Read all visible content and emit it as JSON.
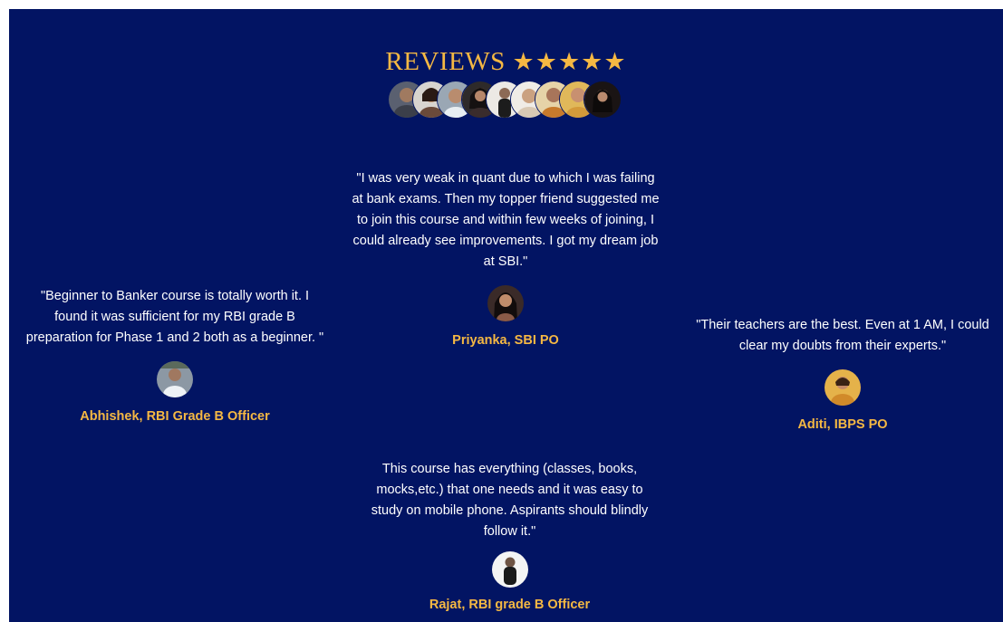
{
  "header": {
    "title": "REVIEWS",
    "stars": "★★★★★"
  },
  "reviews": [
    {
      "id": "priyanka",
      "quote": "\"I was very weak in quant due to which I was failing at bank exams. Then my topper friend suggested me to join this course and within few weeks of joining, I could already see improvements. I got my dream job at SBI.\"",
      "name": "Priyanka, SBI PO"
    },
    {
      "id": "abhishek",
      "quote": "\"Beginner to Banker course is totally worth it. I found it was sufficient for my RBI grade B preparation for Phase 1 and 2 both as a beginner. \"",
      "name": "Abhishek, RBI Grade B Officer"
    },
    {
      "id": "aditi",
      "quote": "\"Their teachers are the best. Even at 1 AM, I could clear my doubts from their experts.\"",
      "name": "Aditi, IBPS PO"
    },
    {
      "id": "rajat",
      "quote": "This course has everything (classes, books, mocks,etc.) that one needs and it was easy to study on mobile phone. Aspirants should blindly follow it.\"",
      "name": "Rajat, RBI grade B Officer"
    }
  ],
  "colors": {
    "background": "#021463",
    "accent": "#f5b843",
    "text": "#ffffff"
  }
}
